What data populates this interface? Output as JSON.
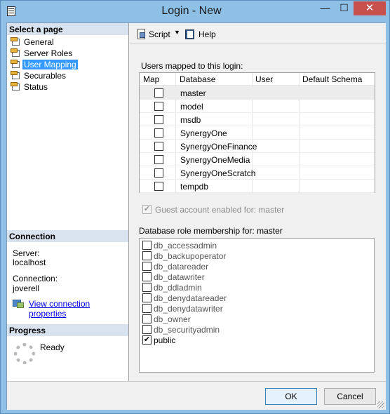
{
  "window": {
    "title": "Login - New",
    "minimize": "—",
    "maximize": "☐",
    "close": "✕"
  },
  "left": {
    "select_header": "Select a page",
    "pages": [
      {
        "label": "General",
        "selected": false
      },
      {
        "label": "Server Roles",
        "selected": false
      },
      {
        "label": "User Mapping",
        "selected": true
      },
      {
        "label": "Securables",
        "selected": false
      },
      {
        "label": "Status",
        "selected": false
      }
    ],
    "connection_header": "Connection",
    "server_label": "Server:",
    "server_value": "localhost",
    "connection_label": "Connection:",
    "connection_value": "joverell",
    "view_link": "View connection properties",
    "progress_header": "Progress",
    "progress_status": "Ready"
  },
  "toolbar": {
    "script_label": "Script",
    "script_caret": "▼",
    "help_label": "Help"
  },
  "mapping": {
    "caption": "Users mapped to this login:",
    "columns": [
      "Map",
      "Database",
      "User",
      "Default Schema"
    ],
    "rows": [
      {
        "database": "master",
        "map": false,
        "user": "",
        "schema": ""
      },
      {
        "database": "model",
        "map": false,
        "user": "",
        "schema": ""
      },
      {
        "database": "msdb",
        "map": false,
        "user": "",
        "schema": ""
      },
      {
        "database": "SynergyOne",
        "map": false,
        "user": "",
        "schema": ""
      },
      {
        "database": "SynergyOneFinance",
        "map": false,
        "user": "",
        "schema": ""
      },
      {
        "database": "SynergyOneMedia",
        "map": false,
        "user": "",
        "schema": ""
      },
      {
        "database": "SynergyOneScratch",
        "map": false,
        "user": "",
        "schema": ""
      },
      {
        "database": "tempdb",
        "map": false,
        "user": "",
        "schema": ""
      }
    ]
  },
  "guest": {
    "label": "Guest account enabled for: master",
    "checked": true,
    "check_glyph": "✔"
  },
  "roles": {
    "caption": "Database role membership for: master",
    "check_glyph": "✔",
    "items": [
      {
        "label": "db_accessadmin",
        "checked": false
      },
      {
        "label": "db_backupoperator",
        "checked": false
      },
      {
        "label": "db_datareader",
        "checked": false
      },
      {
        "label": "db_datawriter",
        "checked": false
      },
      {
        "label": "db_ddladmin",
        "checked": false
      },
      {
        "label": "db_denydatareader",
        "checked": false
      },
      {
        "label": "db_denydatawriter",
        "checked": false
      },
      {
        "label": "db_owner",
        "checked": false
      },
      {
        "label": "db_securityadmin",
        "checked": false
      },
      {
        "label": "public",
        "checked": true
      }
    ]
  },
  "buttons": {
    "ok": "OK",
    "cancel": "Cancel"
  }
}
